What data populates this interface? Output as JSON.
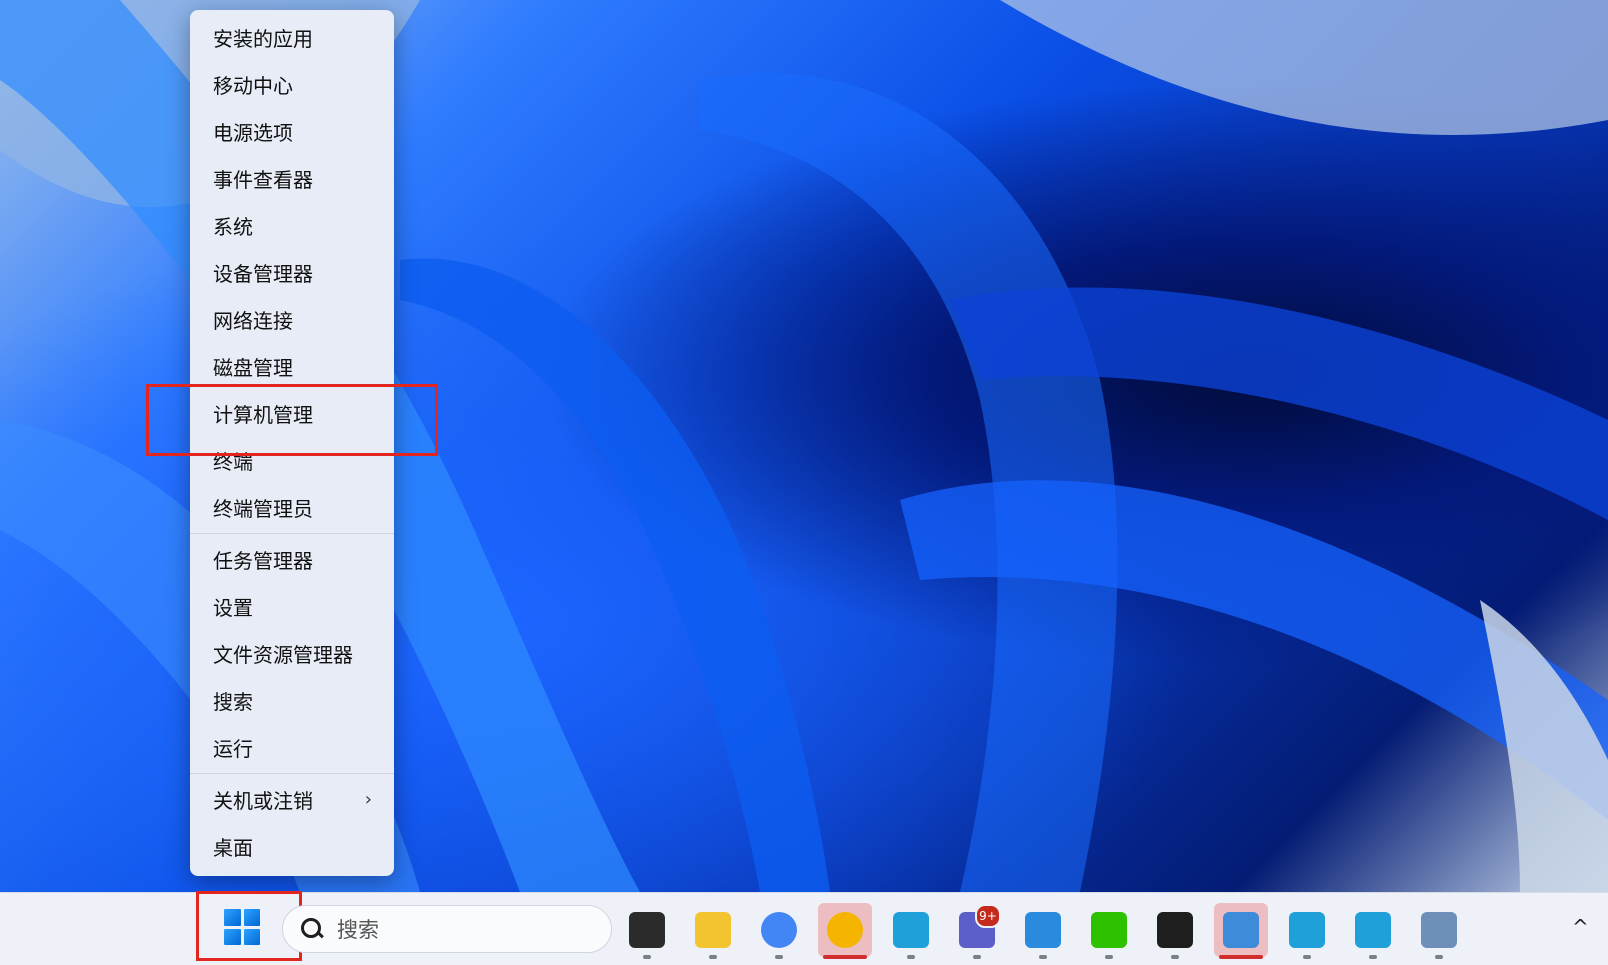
{
  "menu": {
    "group1": [
      {
        "label": "安装的应用",
        "name": "menu-item-installed-apps"
      },
      {
        "label": "移动中心",
        "name": "menu-item-mobility-center"
      },
      {
        "label": "电源选项",
        "name": "menu-item-power-options"
      },
      {
        "label": "事件查看器",
        "name": "menu-item-event-viewer"
      },
      {
        "label": "系统",
        "name": "menu-item-system"
      },
      {
        "label": "设备管理器",
        "name": "menu-item-device-manager"
      },
      {
        "label": "网络连接",
        "name": "menu-item-network-connections"
      },
      {
        "label": "磁盘管理",
        "name": "menu-item-disk-management"
      },
      {
        "label": "计算机管理",
        "name": "menu-item-computer-management"
      },
      {
        "label": "终端",
        "name": "menu-item-terminal"
      },
      {
        "label": "终端管理员",
        "name": "menu-item-terminal-admin"
      }
    ],
    "group2": [
      {
        "label": "任务管理器",
        "name": "menu-item-task-manager"
      },
      {
        "label": "设置",
        "name": "menu-item-settings"
      },
      {
        "label": "文件资源管理器",
        "name": "menu-item-file-explorer"
      },
      {
        "label": "搜索",
        "name": "menu-item-search"
      },
      {
        "label": "运行",
        "name": "menu-item-run"
      }
    ],
    "group3": [
      {
        "label": "关机或注销",
        "name": "menu-item-shutdown-signout",
        "submenu": true
      },
      {
        "label": "桌面",
        "name": "menu-item-desktop"
      }
    ]
  },
  "taskbar": {
    "search_placeholder": "搜索",
    "apps": [
      {
        "name": "task-view-icon",
        "color": "#2b2b2b",
        "active": false
      },
      {
        "name": "file-explorer-icon",
        "color": "#f4c430",
        "active": false
      },
      {
        "name": "chrome-icon",
        "color": "#4285f4",
        "active": false
      },
      {
        "name": "chrome-canary-icon",
        "color": "#f4b400",
        "active": true
      },
      {
        "name": "edge-profile-icon",
        "color": "#1fa0d8",
        "active": false
      },
      {
        "name": "teams-icon",
        "color": "#5b5fc7",
        "active": false,
        "badge": "9+"
      },
      {
        "name": "quick-assist-icon",
        "color": "#2a8bde",
        "active": false
      },
      {
        "name": "wechat-icon",
        "color": "#2dc100",
        "active": false
      },
      {
        "name": "terminal-icon",
        "color": "#1e1e1e",
        "active": false
      },
      {
        "name": "remote-desktop-icon",
        "color": "#3d8bd9",
        "active": true
      },
      {
        "name": "edge-icon",
        "color": "#1fa0d8",
        "active": false
      },
      {
        "name": "edge-yl-profile-icon",
        "color": "#1fa0d8",
        "active": false
      },
      {
        "name": "network-computer-icon",
        "color": "#6e8fb7",
        "active": false
      }
    ],
    "tray_chevron": "^"
  }
}
